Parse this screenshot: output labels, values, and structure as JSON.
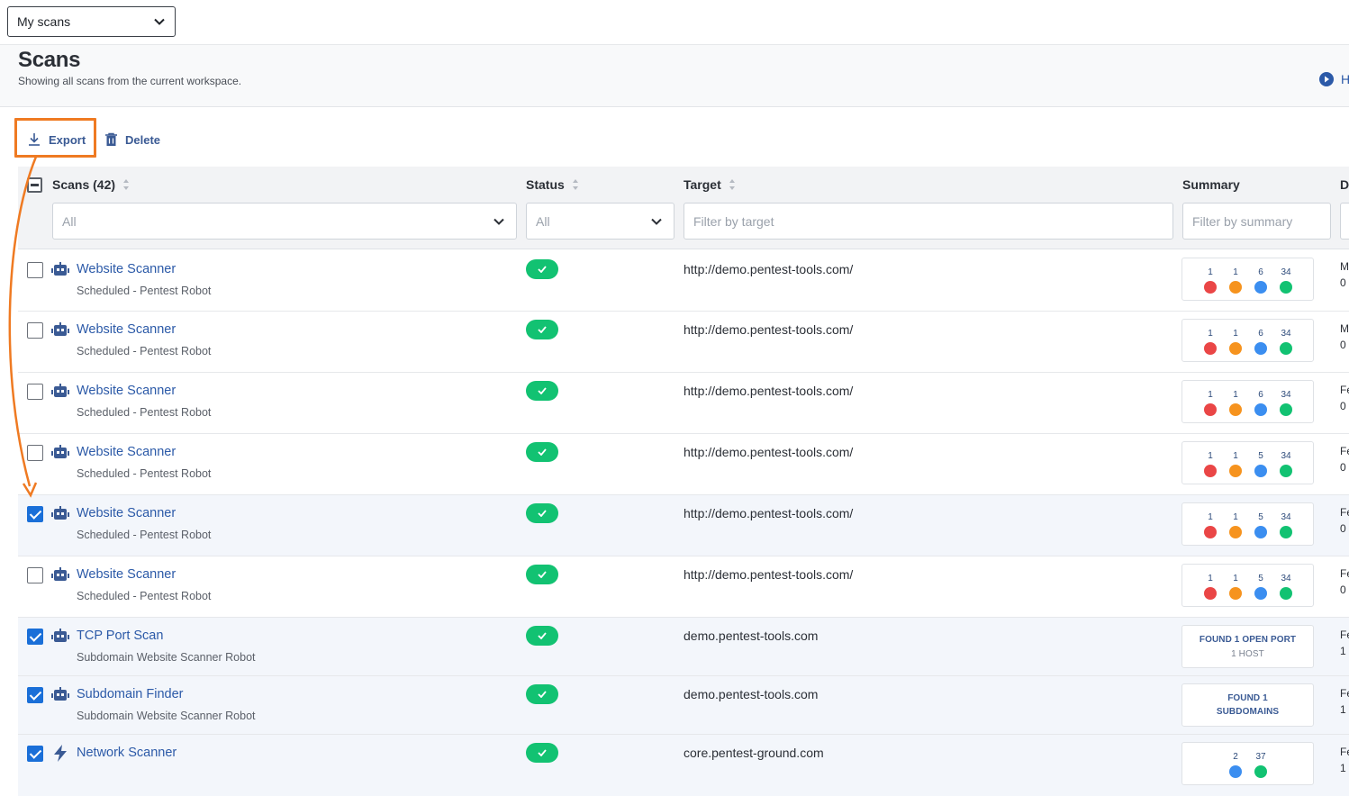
{
  "workspace_select": {
    "value": "My scans"
  },
  "header": {
    "title": "Scans",
    "subtitle": "Showing all scans from the current workspace.",
    "help_label": "H"
  },
  "actions": {
    "export_label": "Export",
    "delete_label": "Delete"
  },
  "columns": {
    "scans": "Scans (42)",
    "status": "Status",
    "target": "Target",
    "summary": "Summary",
    "date": "D"
  },
  "filters": {
    "scans_value": "All",
    "status_value": "All",
    "target_placeholder": "Filter by target",
    "summary_placeholder": "Filter by summary"
  },
  "colors": {
    "high": "#ea4646",
    "medium": "#f6931e",
    "low": "#3b8ef0",
    "info": "#12c272",
    "accent": "#ef7a22"
  },
  "rows": [
    {
      "name": "Website Scanner",
      "sub": "Scheduled - Pentest Robot",
      "target": "http://demo.pentest-tools.com/",
      "checked": false,
      "icon": "robot-icon",
      "counts": [
        "1",
        "1",
        "6",
        "34"
      ],
      "date": [
        "M",
        "0"
      ]
    },
    {
      "name": "Website Scanner",
      "sub": "Scheduled - Pentest Robot",
      "target": "http://demo.pentest-tools.com/",
      "checked": false,
      "icon": "robot-icon",
      "counts": [
        "1",
        "1",
        "6",
        "34"
      ],
      "date": [
        "M",
        "0"
      ]
    },
    {
      "name": "Website Scanner",
      "sub": "Scheduled - Pentest Robot",
      "target": "http://demo.pentest-tools.com/",
      "checked": false,
      "icon": "robot-icon",
      "counts": [
        "1",
        "1",
        "6",
        "34"
      ],
      "date": [
        "Fe",
        "0"
      ]
    },
    {
      "name": "Website Scanner",
      "sub": "Scheduled - Pentest Robot",
      "target": "http://demo.pentest-tools.com/",
      "checked": false,
      "icon": "robot-icon",
      "counts": [
        "1",
        "1",
        "5",
        "34"
      ],
      "date": [
        "Fe",
        "0"
      ]
    },
    {
      "name": "Website Scanner",
      "sub": "Scheduled - Pentest Robot",
      "target": "http://demo.pentest-tools.com/",
      "checked": true,
      "icon": "robot-icon",
      "counts": [
        "1",
        "1",
        "5",
        "34"
      ],
      "date": [
        "Fe",
        "0"
      ]
    },
    {
      "name": "Website Scanner",
      "sub": "Scheduled - Pentest Robot",
      "target": "http://demo.pentest-tools.com/",
      "checked": false,
      "icon": "robot-icon",
      "counts": [
        "1",
        "1",
        "5",
        "34"
      ],
      "date": [
        "Fe",
        "0"
      ]
    },
    {
      "name": "TCP Port Scan",
      "sub": "Subdomain Website Scanner Robot",
      "target": "demo.pentest-tools.com",
      "checked": true,
      "icon": "robot-icon",
      "summary_text": [
        "FOUND 1 OPEN PORT",
        "1 HOST"
      ],
      "date": [
        "Fe",
        "1"
      ]
    },
    {
      "name": "Subdomain Finder",
      "sub": "Subdomain Website Scanner Robot",
      "target": "demo.pentest-tools.com",
      "checked": true,
      "icon": "robot-icon",
      "summary_text": [
        "FOUND 1",
        "SUBDOMAINS"
      ],
      "date": [
        "Fe",
        "1"
      ]
    },
    {
      "name": "Network Scanner",
      "sub": "",
      "target": "core.pentest-ground.com",
      "checked": true,
      "icon": "lightning-icon",
      "counts": [
        "2",
        "37"
      ],
      "date": [
        "Fe",
        "1"
      ]
    }
  ]
}
